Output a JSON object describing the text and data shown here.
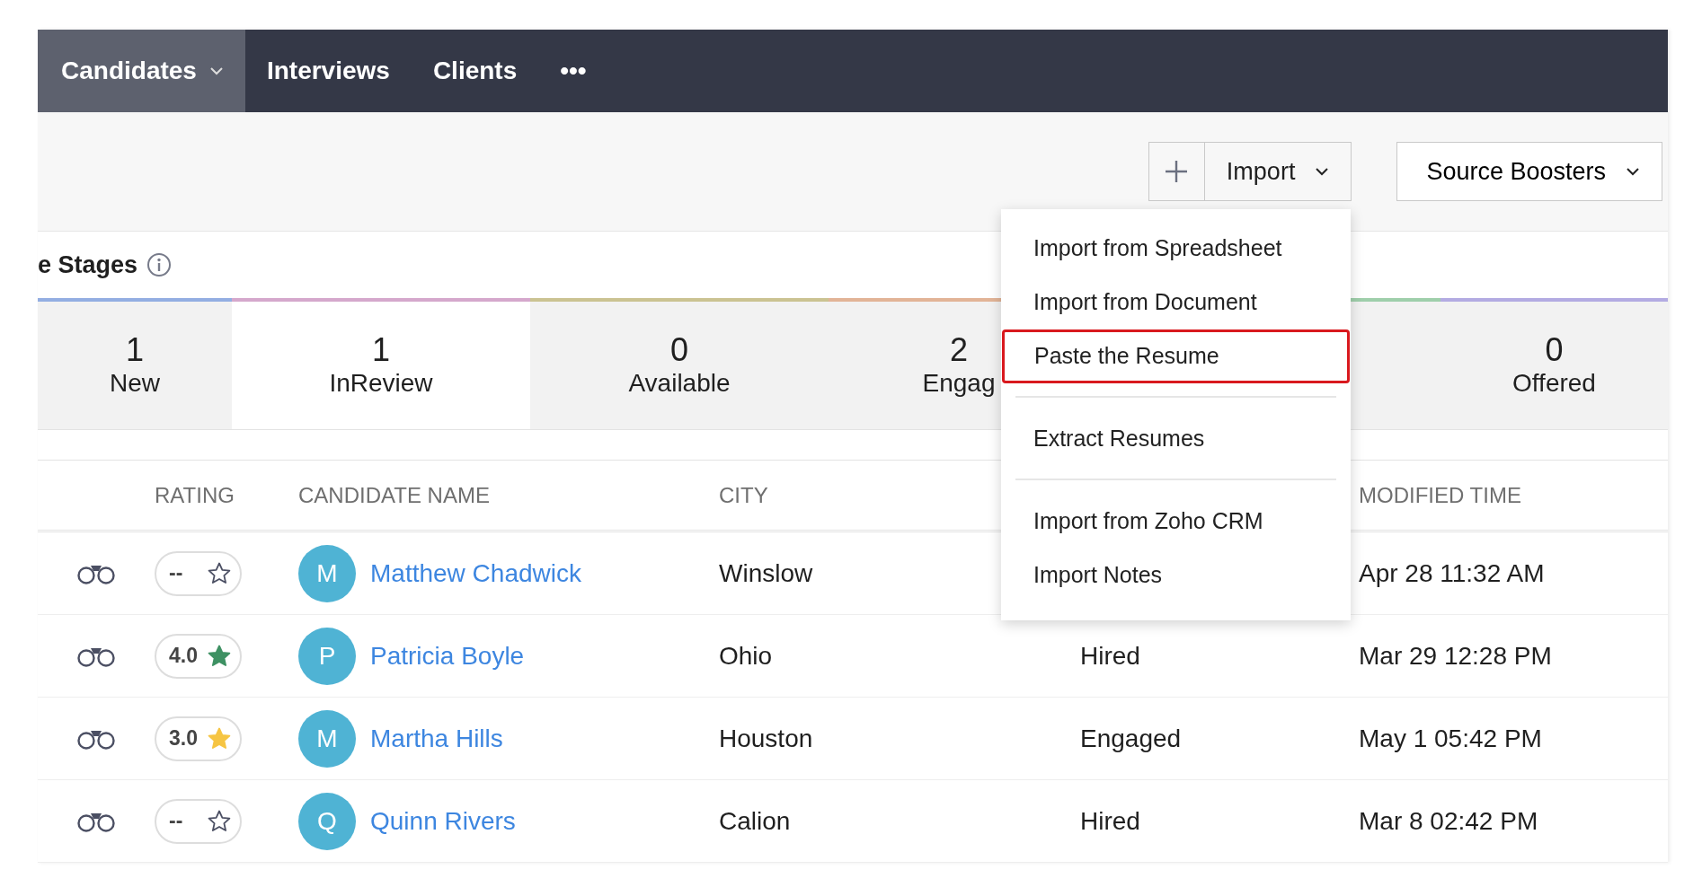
{
  "nav": {
    "tabs": [
      {
        "label": "Candidates",
        "selected": true,
        "has_caret": true
      },
      {
        "label": "Interviews",
        "selected": false,
        "has_caret": false
      },
      {
        "label": "Clients",
        "selected": false,
        "has_caret": false
      },
      {
        "label": "•••",
        "selected": false,
        "has_caret": false
      }
    ]
  },
  "toolbar": {
    "import_button": "Import",
    "source_boosters_button": "Source Boosters"
  },
  "import_menu": {
    "items": [
      {
        "label": "Import from Spreadsheet",
        "selected": false,
        "divider_after": false
      },
      {
        "label": "Import from Document",
        "selected": false,
        "divider_after": false
      },
      {
        "label": "Paste the Resume",
        "selected": true,
        "divider_after": true
      },
      {
        "label": "Extract Resumes",
        "selected": false,
        "divider_after": true
      },
      {
        "label": "Import from Zoho CRM",
        "selected": false,
        "divider_after": false
      },
      {
        "label": "Import Notes",
        "selected": false,
        "divider_after": false
      }
    ]
  },
  "stages": {
    "title": "e Stages",
    "items": [
      {
        "count": "1",
        "label": "New",
        "selected": false,
        "color": "#93aee2"
      },
      {
        "count": "1",
        "label": "InReview",
        "selected": true,
        "color": "#d5a8cc"
      },
      {
        "count": "0",
        "label": "Available",
        "selected": false,
        "color": "#cbc392"
      },
      {
        "count": "2",
        "label": "Engag",
        "selected": false,
        "color": "#e2b497"
      },
      {
        "selected": false,
        "color": "#9fcfab"
      },
      {
        "count": "0",
        "label": "Offered",
        "selected": false,
        "color": "#b3abe2"
      }
    ]
  },
  "table": {
    "columns": [
      "RATING",
      "CANDIDATE NAME",
      "CITY",
      "MODIFIED TIME"
    ],
    "rows": [
      {
        "rating": {
          "text": "--",
          "filled": false
        },
        "initial": "M",
        "name": "Matthew Chadwick",
        "city": "Winslow",
        "modified": "Apr 28 11:32 AM"
      },
      {
        "rating": {
          "text": "4.0",
          "filled": true,
          "color": "#3e9163"
        },
        "initial": "P",
        "name": "Patricia Boyle",
        "city": "Ohio",
        "column_4": "Hired",
        "modified": "Mar 29 12:28 PM"
      },
      {
        "rating": {
          "text": "3.0",
          "filled": true,
          "color": "#f6c543"
        },
        "initial": "M",
        "name": "Martha Hills",
        "city": "Houston",
        "column_4": "Engaged",
        "modified": "May 1 05:42 PM"
      },
      {
        "rating": {
          "text": "--",
          "filled": false
        },
        "initial": "Q",
        "name": "Quinn Rivers",
        "city": "Calion",
        "column_4": "Hired",
        "modified": "Mar 8 02:42 PM"
      }
    ]
  }
}
